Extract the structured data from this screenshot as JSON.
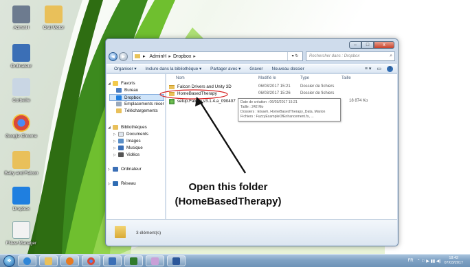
{
  "desktop": {
    "icons": [
      {
        "label": "AdminH",
        "color": "#6d7b8f"
      },
      {
        "label": "Oral Motor",
        "color": "#e9c05a"
      },
      {
        "label": "Ordinateur",
        "color": "#3b6fb6"
      },
      {
        "label": "Corbeille",
        "color": "#c9d6e4"
      },
      {
        "label": "Google Chrome",
        "color": "#d94a38"
      },
      {
        "label": "Baby and Falcon",
        "color": "#e9c05a"
      },
      {
        "label": "Dropbox",
        "color": "#1f7fe0"
      },
      {
        "label": "FNew Manager",
        "color": "#f2f2f2"
      }
    ]
  },
  "window": {
    "caption_buttons": {
      "minimize": "–",
      "maximize": "□",
      "close": "x"
    },
    "nav_back": "◄",
    "nav_forward": "►",
    "address": {
      "parts": [
        "AdminH",
        "Dropbox"
      ],
      "separator": "▸",
      "refresh": "▾ ↻"
    },
    "search": {
      "placeholder": "Rechercher dans : Dropbox",
      "icon": "search-icon"
    },
    "toolbar": {
      "organize": "Organiser ▾",
      "include": "Inclure dans la bibliothèque ▾",
      "share": "Partager avec ▾",
      "burn": "Graver",
      "new_folder": "Nouveau dossier",
      "view_icon": "≡ ▾",
      "pane_icon": "▭"
    },
    "nav": {
      "favorites": "Favoris",
      "desktop": "Bureau",
      "dropbox": "Dropbox",
      "recent": "Emplacements récer",
      "downloads": "Téléchargements",
      "libraries": "Bibliothèques",
      "documents": "Documents",
      "images": "Images",
      "music": "Musique",
      "videos": "Vidéos",
      "computer": "Ordinateur",
      "network": "Réseau"
    },
    "columns": {
      "name": "Nom",
      "modified": "Modifié le",
      "type": "Type",
      "size": "Taille"
    },
    "files": [
      {
        "name": "Falcon Drivers and Unity 3D",
        "modified": "06/03/2017 15:21",
        "type": "Dossier de fichiers",
        "size": ""
      },
      {
        "name": "HomeBasedTherapy",
        "modified": "06/03/2017 15:26",
        "type": "Dossier de fichiers",
        "size": ""
      },
      {
        "name": "setup.Falcon.v3.1.4.a_090407",
        "modified": "",
        "type": "",
        "size": "18 874 Ko"
      }
    ],
    "tooltip": {
      "line1": "Date de création : 06/03/2017 15:21",
      "line2": "Taille : 242 Mo",
      "line3": "Dossiers : Elsaeh, HomeBasedTherapy_Data, Marion",
      "line4": "Fichiers : FuzzyExampleOfEnhancement.fs, ..."
    },
    "status": "3 élément(s)"
  },
  "annotation": {
    "line1": "Open this folder",
    "line2": "(HomeBasedTherapy)"
  },
  "taskbar": {
    "start_icon": "windows-logo-icon",
    "tray_lang": "FR",
    "tray_icons": "⌃ ⚐ ▶ ▮▮ ◀)",
    "time": "18:42",
    "date": "07/03/2017"
  }
}
